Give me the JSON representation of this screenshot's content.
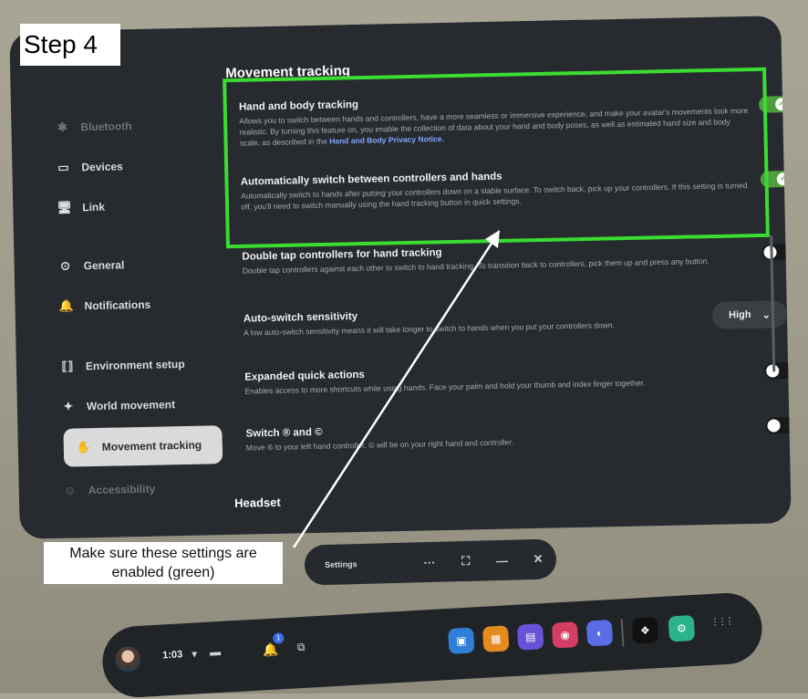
{
  "step_label": "Step 4",
  "note": "Make sure these settings are enabled (green)",
  "sidebar": {
    "items": [
      {
        "label": "Bluetooth",
        "icon": "bluetooth-icon",
        "glyph": "✱"
      },
      {
        "label": "Devices",
        "icon": "devices-icon",
        "glyph": "▭"
      },
      {
        "label": "Link",
        "icon": "link-icon",
        "glyph": "🖥"
      },
      {
        "label": "General",
        "icon": "general-icon",
        "glyph": "⊙"
      },
      {
        "label": "Notifications",
        "icon": "bell-icon",
        "glyph": "🔔"
      },
      {
        "label": "Environment setup",
        "icon": "environment-icon",
        "glyph": "⟦⟧"
      },
      {
        "label": "World movement",
        "icon": "world-movement-icon",
        "glyph": "✦"
      },
      {
        "label": "Movement tracking",
        "icon": "hand-icon",
        "glyph": "✋"
      },
      {
        "label": "Accessibility",
        "icon": "accessibility-icon",
        "glyph": "☺"
      }
    ]
  },
  "content": {
    "section_title": "Movement tracking",
    "settings": [
      {
        "title": "Hand and body tracking",
        "desc": "Allows you to switch between hands and controllers, have a more seamless or immersive experience, and make your avatar's movements look more realistic. By turning this feature on, you enable the collection of data about your hand and body poses, as well as estimated hand size and body scale, as described in the",
        "link": "Hand and Body Privacy Notice.",
        "toggle": "on"
      },
      {
        "title": "Automatically switch between controllers and hands",
        "desc": "Automatically switch to hands after putting your controllers down on a stable surface. To switch back, pick up your controllers. If this setting is turned off, you'll need to switch manually using the hand tracking button in quick settings.",
        "toggle": "on"
      },
      {
        "title": "Double tap controllers for hand tracking",
        "desc": "Double tap controllers against each other to switch to hand tracking. To transition back to controllers, pick them up and press any button.",
        "toggle": "off"
      },
      {
        "title": "Auto-switch sensitivity",
        "desc": "A low auto-switch sensitivity means it will take longer to switch to hands when you put your controllers down.",
        "select_value": "High"
      },
      {
        "title": "Expanded quick actions",
        "desc": "Enables access to more shortcuts while using hands. Face your palm and hold your thumb and index finger together.",
        "toggle": "off"
      },
      {
        "title": "Switch ® and ©",
        "desc": "Move ® to your left hand controller. © will be on your right hand and controller.",
        "toggle": "off"
      }
    ],
    "headset_title": "Headset"
  },
  "settings_bar": {
    "label": "Settings",
    "more": "···",
    "expand": "⛶",
    "minimize": "—",
    "close": "✕"
  },
  "dock": {
    "time": "1:03",
    "wifi": "▾",
    "battery": "▬",
    "badge": "1",
    "apps": [
      {
        "icon": "store-icon",
        "color": "#2f7fd6",
        "glyph": "▣"
      },
      {
        "icon": "shop-icon",
        "color": "#e58a1f",
        "glyph": "▦"
      },
      {
        "icon": "chat-icon",
        "color": "#6a52d8",
        "glyph": "▤"
      },
      {
        "icon": "camera-icon",
        "color": "#d43e62",
        "glyph": "◉"
      },
      {
        "icon": "messenger-icon",
        "color": "#5a6ce6",
        "glyph": "◐"
      },
      {
        "icon": "meta-app-icon",
        "color": "#111111",
        "glyph": "❖"
      },
      {
        "icon": "settings-app-icon",
        "color": "#2bb38a",
        "glyph": "⚙"
      }
    ],
    "grid_glyph": "⋮⋮⋮"
  }
}
